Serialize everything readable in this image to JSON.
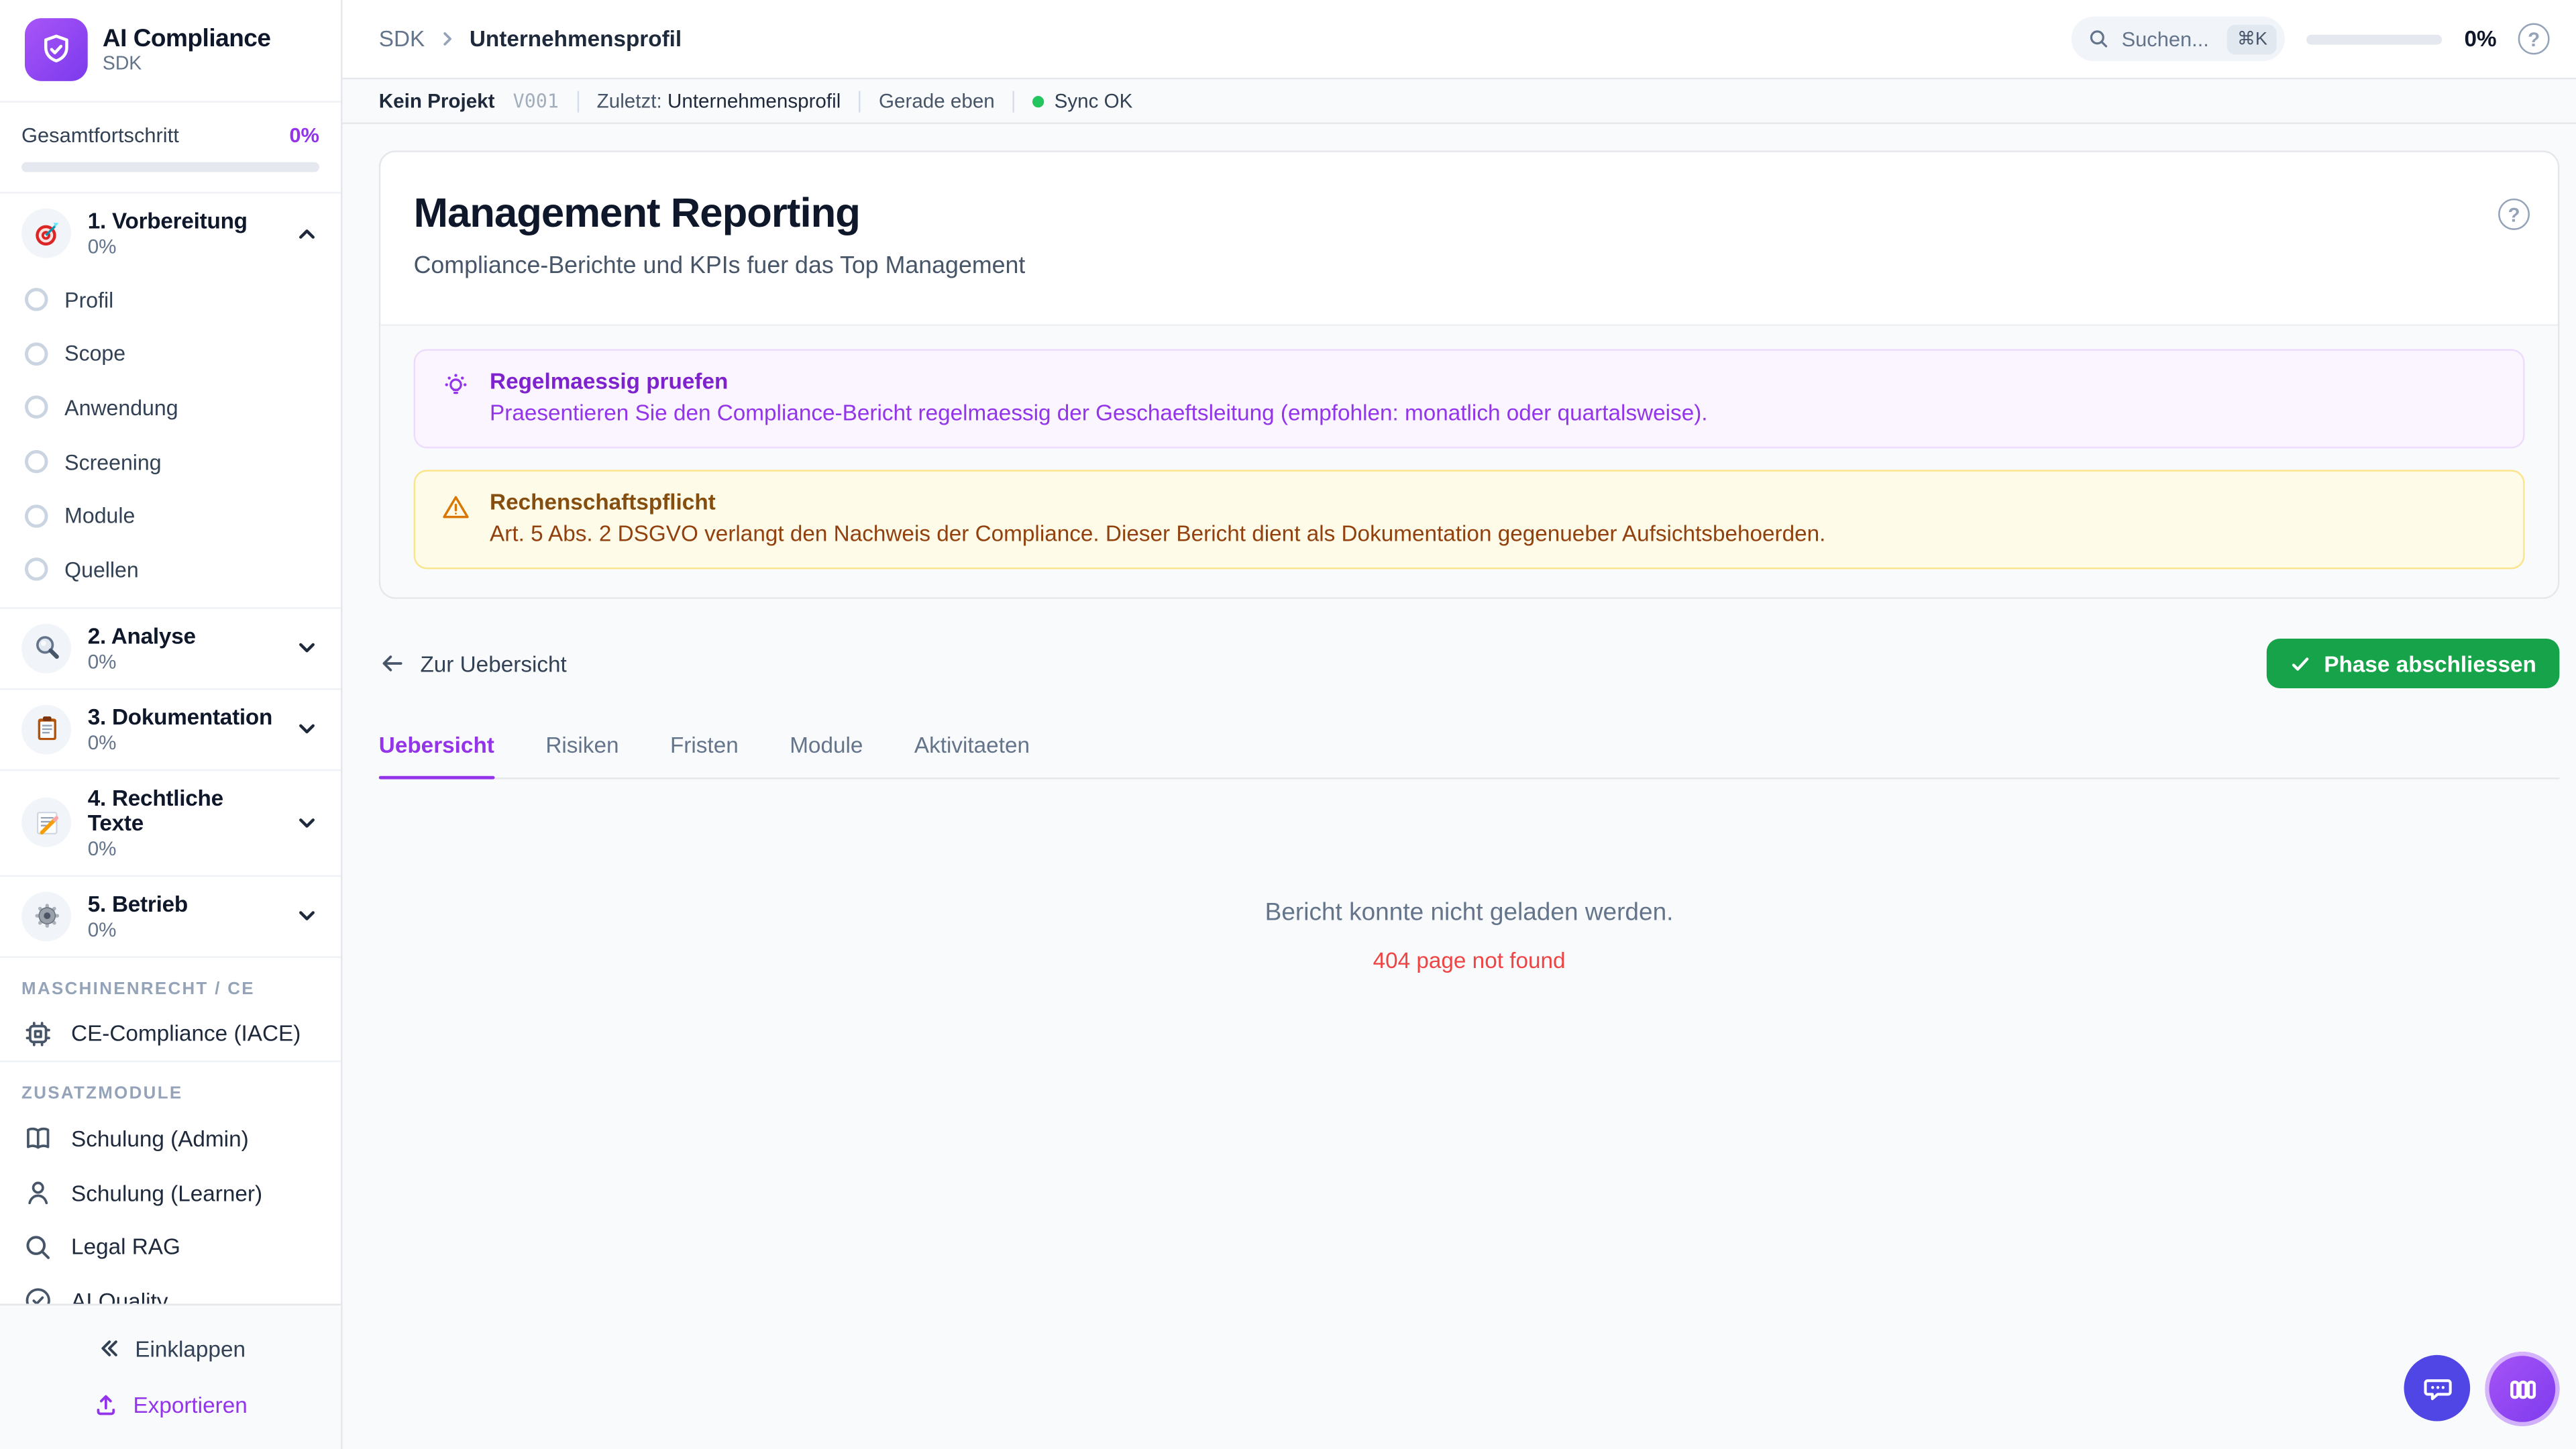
{
  "colors": {
    "accent_purple": "#9333ea",
    "logo_gradient": [
      "#a855f7",
      "#7c3aed"
    ],
    "success_green": "#16a34a",
    "sync_green": "#22c55e",
    "error_red": "#ef4444",
    "tip_text": "#7e22ce",
    "warning_text": "#854d0e",
    "chat_button_indigo": "#4f46e5"
  },
  "sidebar": {
    "logo": {
      "title": "AI Compliance",
      "subtitle": "SDK",
      "icon": "shield-check-icon"
    },
    "progress": {
      "label": "Gesamtfortschritt",
      "value": "0%"
    },
    "phases": [
      {
        "label": "1. Vorbereitung",
        "percent": "0%",
        "icon": "target-icon",
        "expanded": true,
        "children": [
          "Profil",
          "Scope",
          "Anwendung",
          "Screening",
          "Module",
          "Quellen"
        ]
      },
      {
        "label": "2. Analyse",
        "percent": "0%",
        "icon": "magnifier-icon",
        "expanded": false
      },
      {
        "label": "3. Dokumentation",
        "percent": "0%",
        "icon": "clipboard-icon",
        "expanded": false
      },
      {
        "label": "4. Rechtliche Texte",
        "percent": "0%",
        "icon": "memo-pencil-icon",
        "expanded": false
      },
      {
        "label": "5. Betrieb",
        "percent": "0%",
        "icon": "gear-icon",
        "expanded": false
      }
    ],
    "sections": [
      {
        "header": "MASCHINENRECHT / CE",
        "items": [
          {
            "label": "CE-Compliance (IACE)",
            "icon": "chip-icon"
          }
        ]
      },
      {
        "header": "ZUSATZMODULE",
        "items": [
          {
            "label": "Schulung (Admin)",
            "icon": "book-open-icon"
          },
          {
            "label": "Schulung (Learner)",
            "icon": "user-icon"
          },
          {
            "label": "Legal RAG",
            "icon": "search-icon"
          },
          {
            "label": "AI Quality",
            "icon": "check-circle-icon"
          }
        ]
      }
    ],
    "footer": {
      "collapse_label": "Einklappen",
      "export_label": "Exportieren"
    }
  },
  "topbar": {
    "breadcrumb": {
      "root": "SDK",
      "current": "Unternehmensprofil"
    },
    "search": {
      "placeholder": "Suchen...",
      "shortcut": "⌘K"
    },
    "progress_value": "0%"
  },
  "statusbar": {
    "project": "Kein Projekt",
    "version": "V001",
    "last_label": "Zuletzt:",
    "last_value": "Unternehmensprofil",
    "time": "Gerade eben",
    "sync": "Sync OK"
  },
  "main": {
    "title": "Management Reporting",
    "subtitle": "Compliance-Berichte und KPIs fuer das Top Management",
    "callouts": [
      {
        "type": "tip",
        "icon": "lightbulb-icon",
        "title": "Regelmaessig pruefen",
        "body": "Praesentieren Sie den Compliance-Bericht regelmaessig der Geschaeftsleitung (empfohlen: monatlich oder quartalsweise)."
      },
      {
        "type": "warning",
        "icon": "warning-triangle-icon",
        "title": "Rechenschaftspflicht",
        "body": "Art. 5 Abs. 2 DSGVO verlangt den Nachweis der Compliance. Dieser Bericht dient als Dokumentation gegenueber Aufsichtsbehoerden."
      }
    ],
    "back_link": "Zur Uebersicht",
    "complete_button": "Phase abschliessen",
    "tabs": [
      "Uebersicht",
      "Risiken",
      "Fristen",
      "Module",
      "Aktivitaeten"
    ],
    "active_tab": "Uebersicht",
    "empty": {
      "message": "Bericht konnte nicht geladen werden.",
      "error": "404 page not found"
    }
  }
}
